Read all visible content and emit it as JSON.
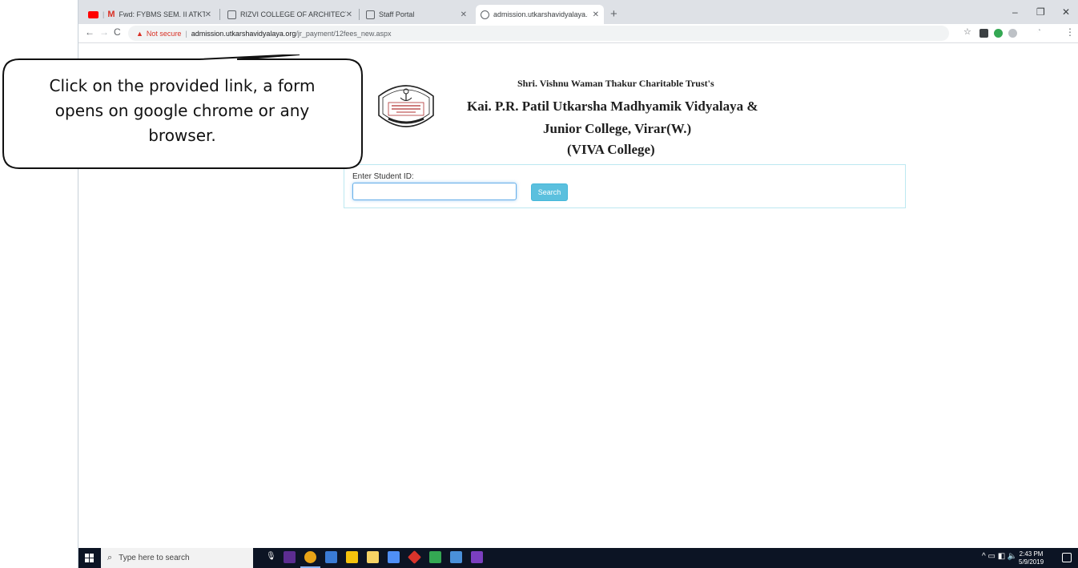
{
  "browser": {
    "tabs": [
      {
        "label": "Fwd: FYBMS SEM. II ATKT CHOIC",
        "icon": "gmail-icon"
      },
      {
        "label": "RIZVI COLLEGE OF ARCHITECTUI",
        "icon": "page-icon"
      },
      {
        "label": "Staff Portal",
        "icon": "page-icon"
      },
      {
        "label": "admission.utkarshavidyalaya.org",
        "icon": "globe-icon"
      }
    ],
    "new_tab": "+",
    "security_label": "Not secure",
    "url_host": "admission.utkarshavidyalaya.org",
    "url_path": "/jr_payment/12fees_new.aspx"
  },
  "page": {
    "trust_name": "Shri. Vishnu Waman Thakur Charitable Trust's",
    "school_line1": "Kai. P.R. Patil Utkarsha Madhyamik Vidyalaya &",
    "school_line2": "Junior College, Virar(W.)",
    "school_line3": "(VIVA College)",
    "student_id_label": "Enter Student ID:",
    "student_id_value": "",
    "search_button": "Search"
  },
  "callout": {
    "text": "Click on the provided link, a form opens on google chrome or any browser."
  },
  "taskbar": {
    "search_placeholder": "Type here to search",
    "time": "2:43 PM",
    "date": "5/9/2019"
  },
  "colors": {
    "accent": "#5bc0de",
    "warning": "#d93025",
    "taskbar": "#0c1424"
  }
}
